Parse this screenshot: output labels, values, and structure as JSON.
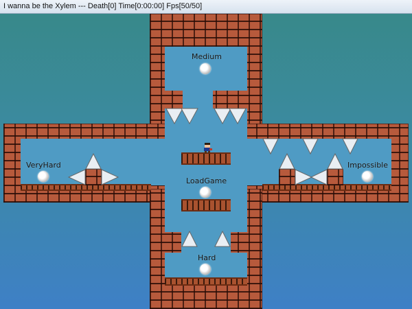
{
  "window": {
    "title": "I wanna be the Xylem --- Death[0] Time[0:00:00] Fps[50/50]"
  },
  "labels": {
    "medium": "Medium",
    "very_hard": "VeryHard",
    "load_game": "LoadGame",
    "impossible": "Impossible",
    "hard": "Hard"
  },
  "colors": {
    "brick": "#b75a3c",
    "sky_top": "#38898a",
    "sky_bottom": "#3e80c6",
    "room": "#4f9bc4"
  }
}
